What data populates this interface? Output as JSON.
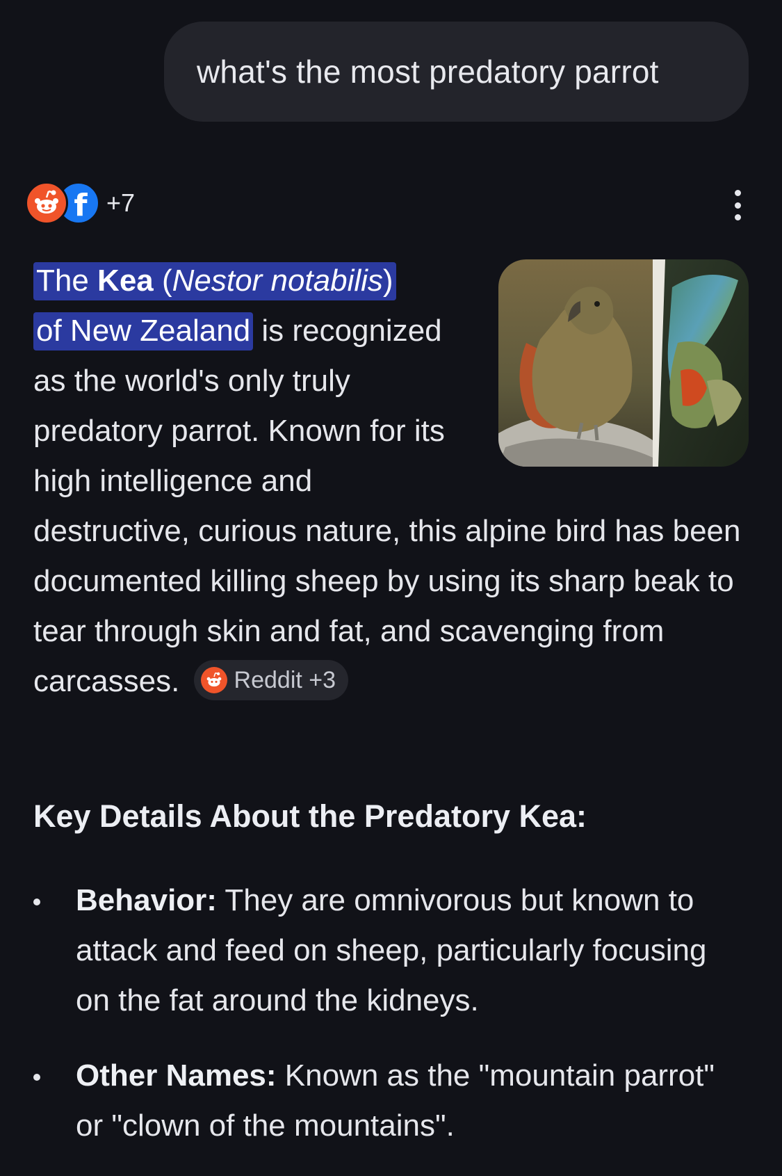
{
  "query": {
    "text": "what's the most predatory parrot"
  },
  "sources": {
    "icons": [
      "reddit-icon",
      "facebook-icon"
    ],
    "more_count": "+7"
  },
  "colors": {
    "background": "#111218",
    "bubble": "#23242b",
    "highlight": "#2b3aa0",
    "reddit": "#f0542a",
    "facebook": "#1877f2"
  },
  "answer": {
    "hl_the": "The ",
    "hl_kea": "Kea",
    "hl_paren_open": " (",
    "hl_species": "Nestor notabilis",
    "hl_paren_close": ")",
    "hl_region": "of New Zealand",
    "body": " is recognized as the world's only truly predatory parrot. Known for its high intelligence and destructive, curious nature, this alpine bird has been documented killing sheep by using its sharp beak to tear through skin and fat, and scavenging from carcasses.",
    "citation_label": "Reddit +3",
    "image_alt": "kea-parrot-photos"
  },
  "details": {
    "heading": "Key Details About the Predatory Kea:",
    "items": [
      {
        "label": "Behavior:",
        "text": " They are omnivorous but known to attack and feed on sheep, particularly focusing on the fat around the kidneys."
      },
      {
        "label": "Other Names:",
        "text": " Known as the \"mountain parrot\" or \"clown of the mountains\"."
      }
    ]
  }
}
